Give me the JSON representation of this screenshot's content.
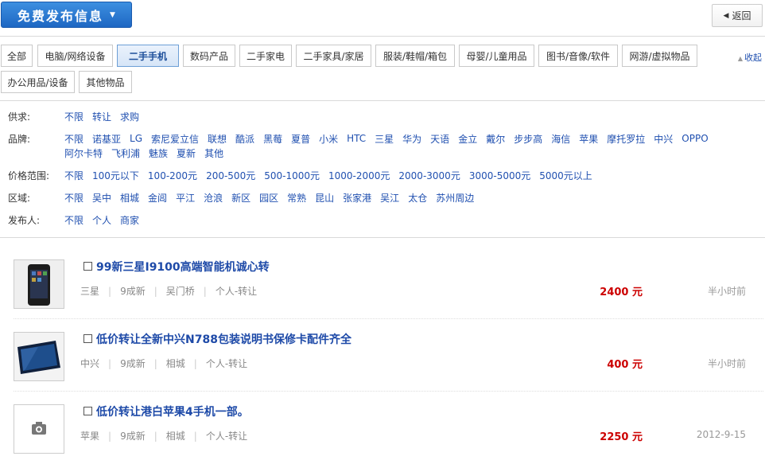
{
  "header": {
    "publish_label": "免费发布信息",
    "back_label": "返回"
  },
  "categories": [
    "全部",
    "电脑/网络设备",
    "二手手机",
    "数码产品",
    "二手家电",
    "二手家具/家居",
    "服装/鞋帽/箱包",
    "母婴/儿童用品",
    "图书/音像/软件",
    "网游/虚拟物品",
    "办公用品/设备",
    "其他物品"
  ],
  "active_category": "二手手机",
  "collapse_label": "收起",
  "filters": {
    "supply": {
      "label": "供求:",
      "options": [
        "不限",
        "转让",
        "求购"
      ]
    },
    "brand": {
      "label": "品牌:",
      "options": [
        "不限",
        "诺基亚",
        "LG",
        "索尼爱立信",
        "联想",
        "酷派",
        "黑莓",
        "夏普",
        "小米",
        "HTC",
        "三星",
        "华为",
        "天语",
        "金立",
        "戴尔",
        "步步高",
        "海信",
        "苹果",
        "摩托罗拉",
        "中兴",
        "OPPO",
        "阿尔卡特",
        "飞利浦",
        "魅族",
        "夏新",
        "其他"
      ]
    },
    "price": {
      "label": "价格范围:",
      "options": [
        "不限",
        "100元以下",
        "100-200元",
        "200-500元",
        "500-1000元",
        "1000-2000元",
        "2000-3000元",
        "3000-5000元",
        "5000元以上"
      ]
    },
    "area": {
      "label": "区域:",
      "options": [
        "不限",
        "吴中",
        "相城",
        "金阊",
        "平江",
        "沧浪",
        "新区",
        "园区",
        "常熟",
        "昆山",
        "张家港",
        "吴江",
        "太仓",
        "苏州周边"
      ]
    },
    "publisher": {
      "label": "发布人:",
      "options": [
        "不限",
        "个人",
        "商家"
      ]
    }
  },
  "listings": [
    {
      "title": "99新三星I9100高端智能机诚心转",
      "brand": "三星",
      "condition": "9成新",
      "location": "吴门桥",
      "type": "个人-转让",
      "price": "2400 元",
      "time": "半小时前",
      "thumb": "phone-dark"
    },
    {
      "title": "低价转让全新中兴N788包装说明书保修卡配件齐全",
      "brand": "中兴",
      "condition": "9成新",
      "location": "相城",
      "type": "个人-转让",
      "price": "400 元",
      "time": "半小时前",
      "thumb": "phone-blue"
    },
    {
      "title": "低价转让港白苹果4手机一部。",
      "brand": "苹果",
      "condition": "9成新",
      "location": "相城",
      "type": "个人-转让",
      "price": "2250 元",
      "time": "2012-9-15",
      "thumb": "camera-placeholder"
    }
  ]
}
